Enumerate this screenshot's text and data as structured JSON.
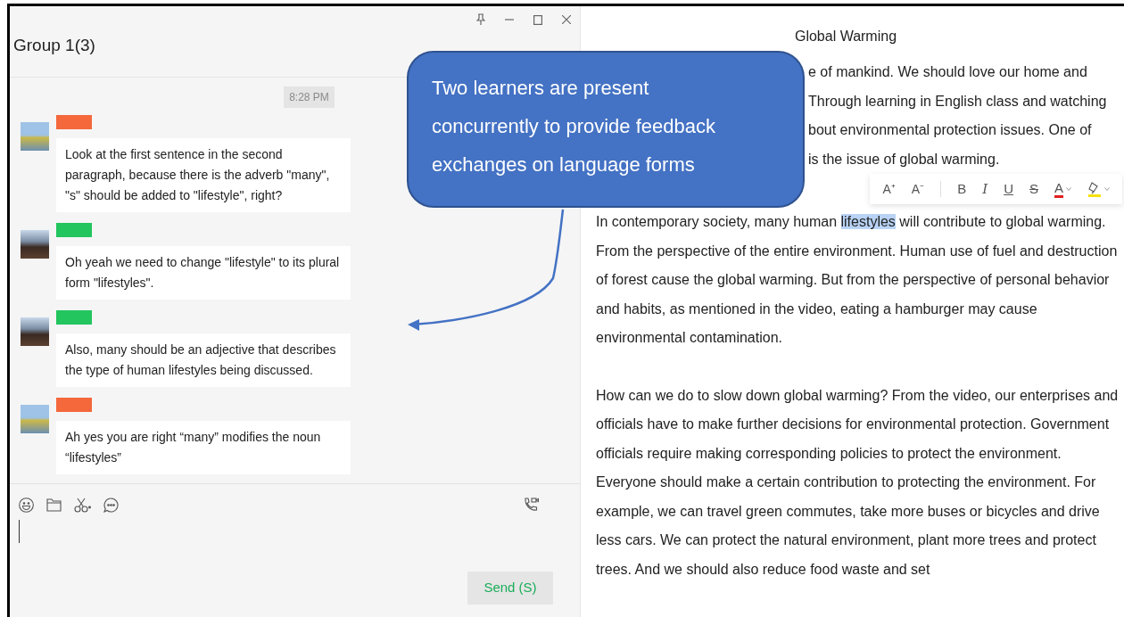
{
  "chat_window": {
    "title": "Group 1(3)",
    "timestamp": "8:28 PM",
    "messages": [
      {
        "color": "#f4683c",
        "text": "Look at the first sentence in the second paragraph, because there is the adverb \"many\", \"s\" should be added to \"lifestyle\", right?"
      },
      {
        "color": "#22c55e",
        "text": "Oh yeah we need to change \"lifestyle\" to its plural form \"lifestyles\"."
      },
      {
        "color": "#22c55e",
        "text": "Also, many should be an adjective that describes the type of human lifestyles being discussed."
      },
      {
        "color": "#f4683c",
        "text": "Ah yes you are right  “many”  modifies the noun  “lifestyles”"
      }
    ],
    "send_button": "Send (S)"
  },
  "document": {
    "title": "Global Warming",
    "covered_paragraph_lines": [
      "e of mankind. We should love our home and",
      "Through learning in English class and watching",
      "bout environmental protection issues. One of",
      "is the issue of global warming."
    ],
    "format_toolbar": [
      {
        "kind": "grow",
        "label": "A⁺"
      },
      {
        "kind": "shrink",
        "label": "A⁻"
      },
      {
        "kind": "bold",
        "label": "B"
      },
      {
        "kind": "italic",
        "label": "I"
      },
      {
        "kind": "underline",
        "label": "U"
      },
      {
        "kind": "strike",
        "label": "S"
      },
      {
        "kind": "font-color",
        "label": "A"
      },
      {
        "kind": "highlight"
      }
    ],
    "paragraphs": [
      {
        "segments": [
          {
            "text": "In contemporary society, many human ",
            "selected": false
          },
          {
            "text": "lifestyles",
            "selected": true
          },
          {
            "text": " will contribute to global warming. From the perspective of the entire environment. Human use of fuel and destruction of forest cause the global warming. But from the perspective of personal behavior and habits, as mentioned in the video, eating a hamburger may cause environmental contamination.",
            "selected": false
          }
        ]
      },
      {
        "segments": [
          {
            "text": "How can we do to slow down global warming? From the video, our enterprises and officials have to make further decisions for environmental protection. Government officials require making corresponding policies to protect the environment. Everyone should make a certain contribution to protecting the environment. For example, we can travel green commutes, take more buses or bicycles and drive less cars. We can protect the natural environment, plant more trees and protect trees. And we should also reduce food waste and set",
            "selected": false
          }
        ]
      }
    ]
  },
  "callout": {
    "text": "Two learners are present concurrently to provide feedback exchanges on language forms"
  }
}
